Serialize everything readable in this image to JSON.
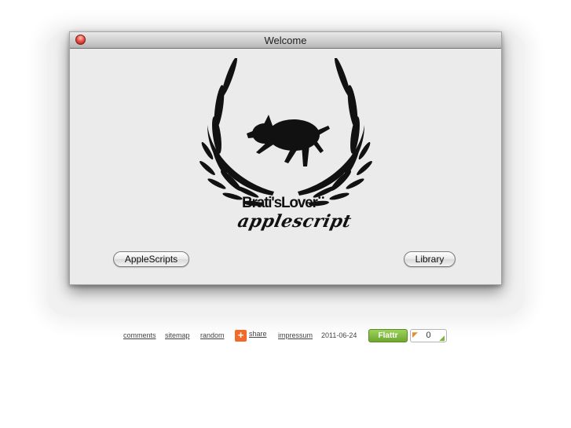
{
  "window": {
    "title": "Welcome",
    "brand_name": "Brati'sLover",
    "brand_mark": "••",
    "brand_subtitle": "applescript",
    "buttons": {
      "applescripts": "AppleScripts",
      "library": "Library"
    },
    "icons": [
      "close-icon",
      "laurel-wreath-icon",
      "pig-icon"
    ]
  },
  "footer": {
    "links": {
      "comments": "comments",
      "sitemap": "sitemap",
      "random": "random",
      "share": "share",
      "impressum": "impressum"
    },
    "share_icon_glyph": "+",
    "date": "2011-06-24",
    "flattr": {
      "label": "Flattr",
      "count": "0"
    }
  },
  "colors": {
    "close_button": "#f0554a",
    "share_icon": "#f26a2b",
    "flattr_green": "#7db542"
  }
}
